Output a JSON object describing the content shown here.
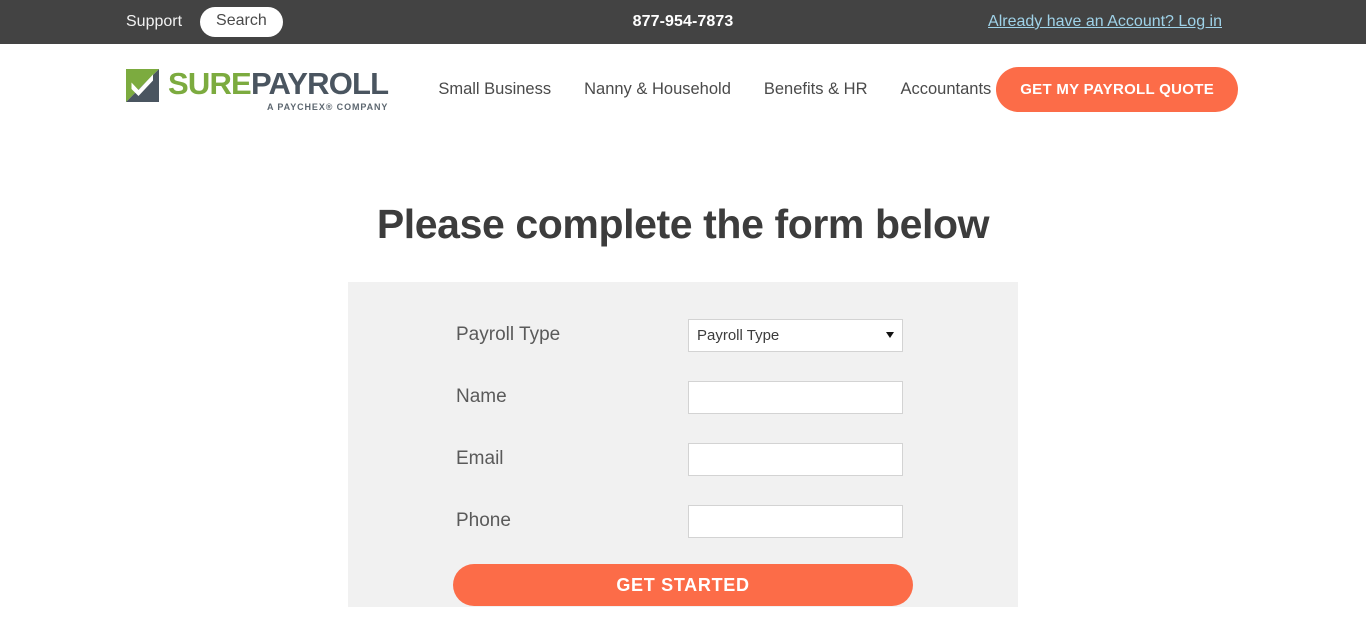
{
  "topbar": {
    "support_label": "Support",
    "search_label": "Search",
    "phone": "877-954-7873",
    "login_label": "Already have an Account? Log in"
  },
  "header": {
    "logo": {
      "word_primary": "SURE",
      "word_secondary": "PAYROLL",
      "tagline": "A PAYCHEX® COMPANY"
    },
    "nav": [
      {
        "label": "Small Business"
      },
      {
        "label": "Nanny & Household"
      },
      {
        "label": "Benefits & HR"
      },
      {
        "label": "Accountants"
      }
    ],
    "cta_label": "GET MY PAYROLL QUOTE"
  },
  "main": {
    "title": "Please complete the form below",
    "form": {
      "fields": [
        {
          "label": "Payroll Type",
          "type": "select",
          "value": "Payroll Type",
          "placeholder": ""
        },
        {
          "label": "Name",
          "type": "text",
          "value": "",
          "placeholder": ""
        },
        {
          "label": "Email",
          "type": "text",
          "value": "",
          "placeholder": ""
        },
        {
          "label": "Phone",
          "type": "text",
          "value": "",
          "placeholder": ""
        }
      ],
      "submit_label": "GET STARTED"
    }
  },
  "colors": {
    "topbar_bg": "#434343",
    "accent_orange": "#fc6c48",
    "logo_green": "#7cab3f",
    "logo_slate": "#4a5560",
    "link_blue": "#9fd2e8",
    "panel_bg": "#f1f1f1"
  }
}
